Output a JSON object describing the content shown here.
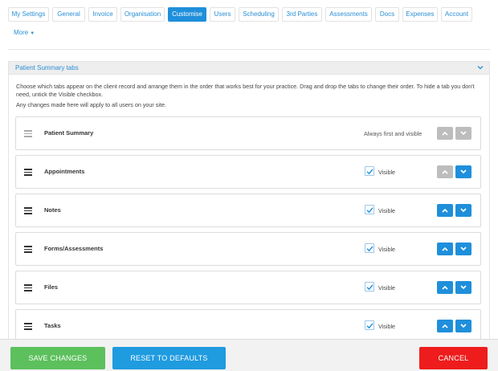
{
  "tabs": [
    {
      "label": "My Settings"
    },
    {
      "label": "General"
    },
    {
      "label": "Invoice"
    },
    {
      "label": "Organisation"
    },
    {
      "label": "Customise",
      "active": true
    },
    {
      "label": "Users"
    },
    {
      "label": "Scheduling"
    },
    {
      "label": "3rd Parties"
    },
    {
      "label": "Assessments"
    },
    {
      "label": "Docs"
    },
    {
      "label": "Expenses"
    },
    {
      "label": "Account"
    }
  ],
  "more_label": "More",
  "panel": {
    "title": "Patient Summary tabs",
    "description": "Choose which tabs appear on the client record and arrange them in the order that works best for your practice. Drag and drop the tabs to change their order. To hide a tab you don't need, untick the Visible checkbox.",
    "note": "Any changes made here will apply to all users on your site."
  },
  "rows": [
    {
      "label": "Patient Summary",
      "fixed": true,
      "fixed_text": "Always first and visible",
      "up_enabled": false,
      "down_enabled": false
    },
    {
      "label": "Appointments",
      "visible_label": "Visible",
      "visible": true,
      "up_enabled": false,
      "down_enabled": true
    },
    {
      "label": "Notes",
      "visible_label": "Visible",
      "visible": true,
      "up_enabled": true,
      "down_enabled": true
    },
    {
      "label": "Forms/Assessments",
      "visible_label": "Visible",
      "visible": true,
      "up_enabled": true,
      "down_enabled": true
    },
    {
      "label": "Files",
      "visible_label": "Visible",
      "visible": true,
      "up_enabled": true,
      "down_enabled": true
    },
    {
      "label": "Tasks",
      "visible_label": "Visible",
      "visible": true,
      "up_enabled": true,
      "down_enabled": true
    }
  ],
  "footer": {
    "save_label": "SAVE CHANGES",
    "reset_label": "RESET TO DEFAULTS",
    "cancel_label": "CANCEL"
  },
  "colors": {
    "accent": "#1f8fdb",
    "save": "#5cc05c",
    "reset": "#1f9be0",
    "cancel": "#ee1c1c",
    "disabled": "#bdbdbd"
  }
}
